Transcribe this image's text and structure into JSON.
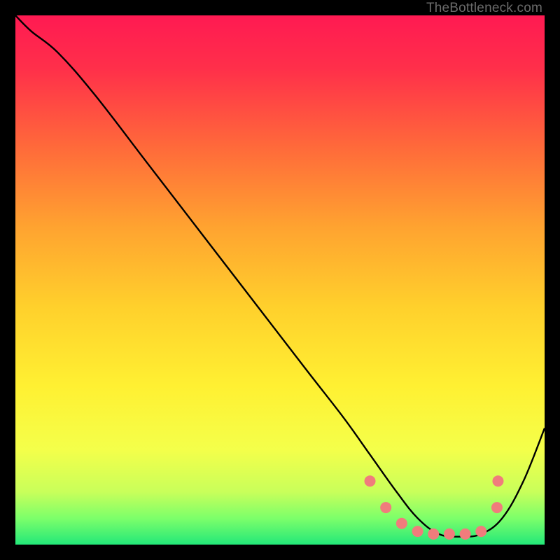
{
  "watermark": "TheBottleneck.com",
  "chart_data": {
    "type": "line",
    "title": "",
    "xlabel": "",
    "ylabel": "",
    "xlim": [
      0,
      100
    ],
    "ylim": [
      0,
      100
    ],
    "series": [
      {
        "name": "bottleneck-curve",
        "x": [
          0,
          3,
          8,
          15,
          25,
          35,
          45,
          55,
          62,
          67,
          72,
          76,
          80,
          84,
          88,
          92,
          96,
          100
        ],
        "y": [
          100,
          97,
          93,
          85,
          72,
          59,
          46,
          33,
          24,
          17,
          10,
          5,
          2,
          1.5,
          2,
          5,
          12,
          22
        ]
      }
    ],
    "markers": {
      "name": "optimal-range-dots",
      "x": [
        67,
        70,
        73,
        76,
        79,
        82,
        85,
        88,
        91,
        91.2
      ],
      "y": [
        12,
        7,
        4,
        2.5,
        2,
        2,
        2,
        2.5,
        7,
        12
      ]
    },
    "gradient_stops": [
      {
        "pos": 0.0,
        "color": "#ff1a52"
      },
      {
        "pos": 0.1,
        "color": "#ff2f4a"
      },
      {
        "pos": 0.25,
        "color": "#ff6a3a"
      },
      {
        "pos": 0.4,
        "color": "#ffa330"
      },
      {
        "pos": 0.55,
        "color": "#ffd02c"
      },
      {
        "pos": 0.7,
        "color": "#fff032"
      },
      {
        "pos": 0.82,
        "color": "#f4ff4a"
      },
      {
        "pos": 0.9,
        "color": "#c9ff5a"
      },
      {
        "pos": 0.95,
        "color": "#7dff6a"
      },
      {
        "pos": 1.0,
        "color": "#23e879"
      }
    ]
  }
}
